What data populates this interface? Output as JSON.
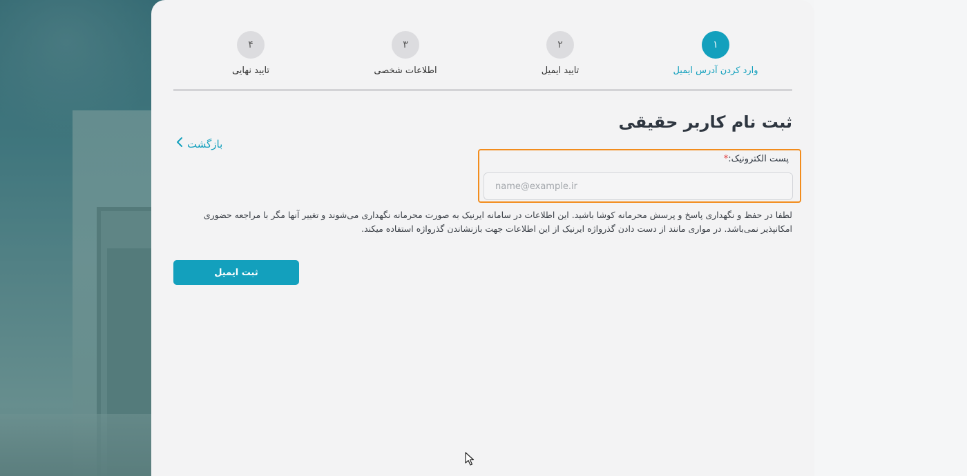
{
  "stepper": {
    "steps": [
      {
        "number": "۱",
        "label": "وارد کردن آدرس ایمیل",
        "active": true
      },
      {
        "number": "۲",
        "label": "تایید ایمیل",
        "active": false
      },
      {
        "number": "۳",
        "label": "اطلاعات شخصی",
        "active": false
      },
      {
        "number": "۴",
        "label": "تایید نهایی",
        "active": false
      }
    ]
  },
  "page": {
    "title": "ثبت نام کاربر حقیقی",
    "back_label": "بازگشت"
  },
  "email_field": {
    "label": "پست الکترونیک:",
    "required_mark": "*",
    "placeholder": "name@example.ir",
    "value": ""
  },
  "notice": "لطفا در حفظ و نگهداری پاسخ و پرسش محرمانه کوشا باشید. این اطلاعات در سامانه ایرنیک به صورت محرمانه نگهداری می‌شوند و تغییر آنها مگر با مراجعه حضوری امکانپذیر نمی‌باشد. در مواری مانند از دست دادن گذرواژه ایرنیک از این اطلاعات جهت بازنشاندن گذرواژه استفاده میکند.",
  "submit": {
    "label": "ثبت ایمیل"
  },
  "colors": {
    "accent": "#13a0bd",
    "highlight_border": "#f28c1c",
    "required": "#e03b3b"
  }
}
